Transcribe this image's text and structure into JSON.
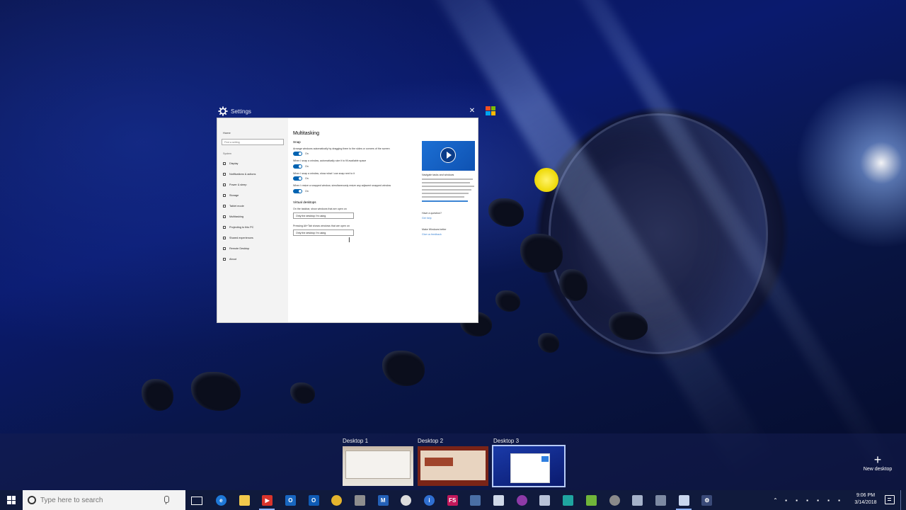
{
  "settings_window": {
    "title": "Settings",
    "close_glyph": "✕",
    "nav": {
      "home": "Home",
      "find_placeholder": "Find a setting",
      "group": "System",
      "items": [
        "Display",
        "Notifications & actions",
        "Power & sleep",
        "Storage",
        "Tablet mode",
        "Multitasking",
        "Projecting to this PC",
        "Shared experiences",
        "Remote Desktop",
        "About"
      ]
    },
    "main": {
      "heading": "Multitasking",
      "snap_heading": "Snap",
      "snap_options": [
        {
          "text": "Arrange windows automatically by dragging them to the sides or corners of the screen",
          "state": "On"
        },
        {
          "text": "When I snap a window, automatically size it to fill available space",
          "state": "On"
        },
        {
          "text": "When I snap a window, show what I can snap next to it",
          "state": "On"
        },
        {
          "text": "When I resize a snapped window, simultaneously resize any adjacent snapped window",
          "state": "On"
        }
      ],
      "vd_heading": "Virtual desktops",
      "vd_options": [
        {
          "label": "On the taskbar, show windows that are open on",
          "value": "Only the desktop I'm using"
        },
        {
          "label": "Pressing Alt+Tab shows windows that are open on",
          "value": "Only the desktop I'm using"
        }
      ]
    },
    "side": {
      "video_title": "Navigate tasks and windows",
      "question": "Have a question?",
      "get_help": "Get help",
      "feedback_heading": "Make Windows better",
      "feedback_link": "Give us feedback"
    }
  },
  "task_view": {
    "desktops": [
      {
        "label": "Desktop 1",
        "active": false
      },
      {
        "label": "Desktop 2",
        "active": false
      },
      {
        "label": "Desktop 3",
        "active": true
      }
    ],
    "new_desktop": "New desktop"
  },
  "taskbar": {
    "search_placeholder": "Type here to search",
    "apps": [
      {
        "name": "edge-icon",
        "glyph": "e",
        "color": "#1e78d7",
        "round": true,
        "running": false
      },
      {
        "name": "file-explorer-icon",
        "glyph": "",
        "color": "#f2c94c",
        "round": false,
        "running": false
      },
      {
        "name": "presentation-app-icon",
        "glyph": "▶",
        "color": "#d9342b",
        "round": false,
        "running": true
      },
      {
        "name": "outlook-icon",
        "glyph": "O",
        "color": "#1866c0",
        "round": false,
        "running": false
      },
      {
        "name": "outlook-alt-icon",
        "glyph": "O",
        "color": "#0f5bb5",
        "round": false,
        "running": false
      },
      {
        "name": "chrome-icon",
        "glyph": "",
        "color": "#e4b42d",
        "round": true,
        "running": false
      },
      {
        "name": "media-icon",
        "glyph": "",
        "color": "#8e8e8e",
        "round": false,
        "running": false
      },
      {
        "name": "mail-app-icon",
        "glyph": "M",
        "color": "#2461b8",
        "round": false,
        "running": false
      },
      {
        "name": "app-circle-icon",
        "glyph": "",
        "color": "#dcdcdc",
        "round": true,
        "running": false
      },
      {
        "name": "info-app-icon",
        "glyph": "i",
        "color": "#2f6fd1",
        "round": true,
        "running": false
      },
      {
        "name": "fs-app-icon",
        "glyph": "FS",
        "color": "#c2185b",
        "round": false,
        "running": false
      },
      {
        "name": "doc-app-icon",
        "glyph": "",
        "color": "#4a6fa5",
        "round": false,
        "running": false
      },
      {
        "name": "cloud-app-icon",
        "glyph": "",
        "color": "#cfd8e8",
        "round": false,
        "running": false
      },
      {
        "name": "purple-app-icon",
        "glyph": "",
        "color": "#8e3aa8",
        "round": true,
        "running": false
      },
      {
        "name": "monitor-app-icon",
        "glyph": "",
        "color": "#b8c2d8",
        "round": false,
        "running": false
      },
      {
        "name": "teal-app-icon",
        "glyph": "",
        "color": "#1fa5a0",
        "round": false,
        "running": false
      },
      {
        "name": "green-doc-app-icon",
        "glyph": "",
        "color": "#70b53a",
        "round": false,
        "running": false
      },
      {
        "name": "gauge-app-icon",
        "glyph": "",
        "color": "#8a8a8a",
        "round": true,
        "running": false
      },
      {
        "name": "tool-app-icon",
        "glyph": "",
        "color": "#a5b2c9",
        "round": false,
        "running": false
      },
      {
        "name": "phone-app-icon",
        "glyph": "",
        "color": "#7d8aa3",
        "round": false,
        "running": false
      },
      {
        "name": "settings-app-icon",
        "glyph": "",
        "color": "#c9d6ee",
        "round": false,
        "running": true
      },
      {
        "name": "gear-app-icon",
        "glyph": "⚙",
        "color": "#3a4a78",
        "round": false,
        "running": false
      }
    ],
    "tray_icons": [
      {
        "name": "tray-chevron-icon",
        "glyph": "⌃"
      },
      {
        "name": "tray-icon-1",
        "glyph": "▪"
      },
      {
        "name": "tray-icon-2",
        "glyph": "▪"
      },
      {
        "name": "tray-icon-3",
        "glyph": "▪"
      },
      {
        "name": "tray-icon-4",
        "glyph": "▪"
      },
      {
        "name": "tray-icon-5",
        "glyph": "▪"
      },
      {
        "name": "tray-icon-6",
        "glyph": "▪"
      }
    ],
    "time": "9:06 PM",
    "date": "3/14/2018"
  }
}
